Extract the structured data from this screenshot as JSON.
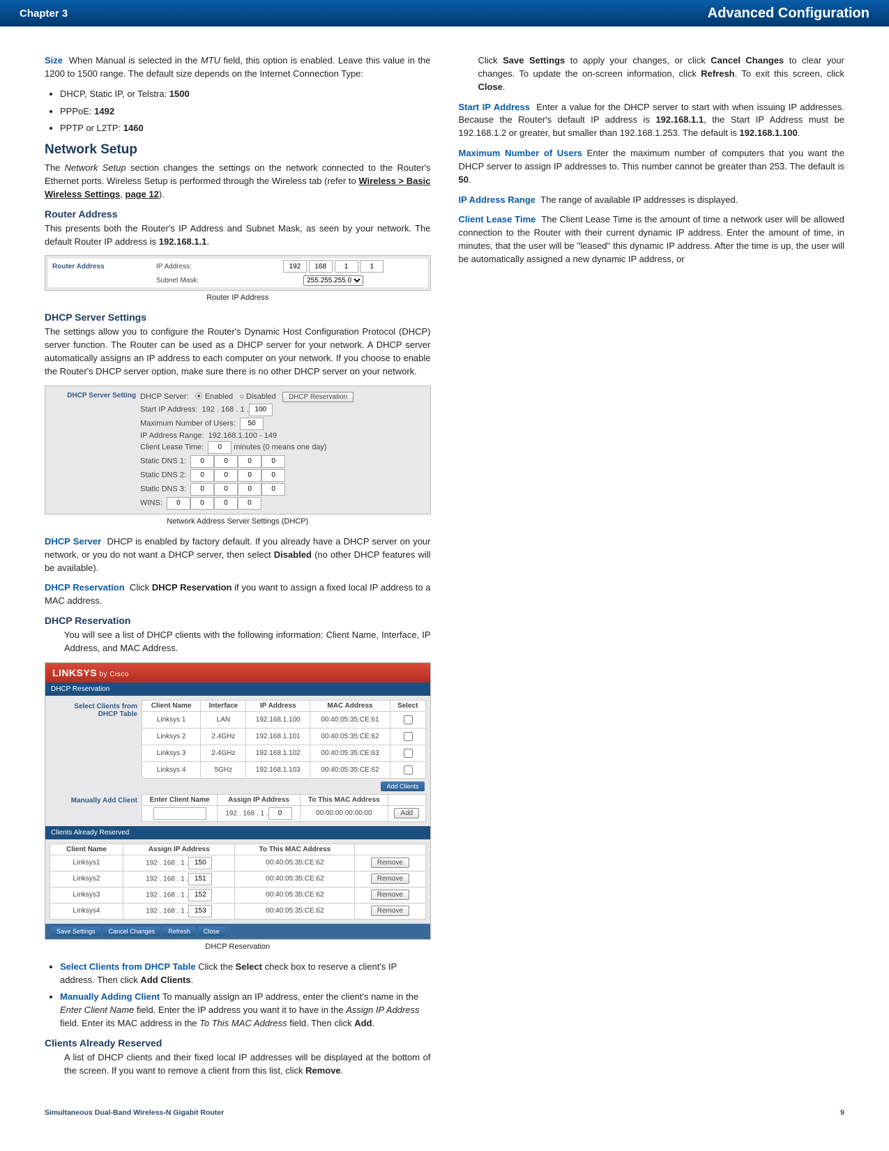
{
  "header": {
    "chapter": "Chapter 3",
    "title": "Advanced Configuration"
  },
  "para_size": {
    "term": "Size",
    "body": "When Manual is selected in the ",
    "ital1": "MTU",
    "body2": " field, this option is enabled. Leave this value in the 1200 to 1500 range. The default size depends on the Internet Connection Type:"
  },
  "size_list": {
    "i1a": "DHCP, Static IP, or Telstra: ",
    "i1b": "1500",
    "i2a": "PPPoE: ",
    "i2b": "1492",
    "i3a": "PPTP or L2TP: ",
    "i3b": "1460"
  },
  "h_netsetup": "Network Setup",
  "p_netsetup_a": "The ",
  "p_netsetup_ital": "Network Setup",
  "p_netsetup_b": " section changes the settings on the network connected to the Router's Ethernet ports. Wireless Setup is performed through the Wireless tab (refer to ",
  "p_netsetup_link": "Wireless > Basic Wireless Settings",
  "p_netsetup_c": ", ",
  "p_netsetup_page": "page 12",
  "p_netsetup_d": ").",
  "h_routeraddr": "Router Address",
  "p_routeraddr_a": "This presents both the Router's IP Address and Subnet Mask, as seen by your network. The default Router IP address is ",
  "p_routeraddr_b": "192.168.1.1",
  "p_routeraddr_c": ".",
  "fig_router": {
    "panel": "Router Address",
    "row1k": "IP Address:",
    "ip1": "192",
    "ip2": "168",
    "ip3": "1",
    "ip4": "1",
    "row2k": "Subnet Mask:",
    "mask": "255.255.255.0",
    "caption": "Router IP Address"
  },
  "h_dhcp": "DHCP Server Settings",
  "p_dhcp_intro": "The settings allow you to configure the Router's Dynamic Host Configuration Protocol (DHCP) server function. The Router can be used as a DHCP server for your network. A DHCP server automatically assigns an IP address to each computer on your network. If you choose to enable the Router's DHCP server option, make sure there is no other DHCP server on your network.",
  "fig_dhcpset": {
    "panel": "DHCP Server Setting",
    "row_srv": "DHCP Server:",
    "opt_en": "Enabled",
    "opt_dis": "Disabled",
    "btn_res": "DHCP Reservation",
    "row_start": "Start IP Address:",
    "start_pref": "192 . 168 . 1 .",
    "start_last": "100",
    "row_max": "Maximum Number of Users:",
    "max_val": "50",
    "row_range": "IP Address Range:",
    "range_val": "192.168.1.100 - 149",
    "row_lease": "Client Lease Time:",
    "lease_val": "0",
    "lease_note": "minutes (0 means one day)",
    "row_d1": "Static DNS 1:",
    "row_d2": "Static DNS 2:",
    "row_d3": "Static DNS 3:",
    "row_wins": "WINS:",
    "zero": "0",
    "caption": "Network Address Server Settings (DHCP)"
  },
  "p_dhcpserver": {
    "term": "DHCP Server",
    "a": "DHCP is enabled by factory default. If you already have a DHCP server on your network, or you do not want a DHCP server, then select ",
    "b": "Disabled",
    "c": " (no other DHCP features will be available)."
  },
  "p_dhcpres": {
    "term": "DHCP Reservation",
    "a": "Click ",
    "b": "DHCP Reservation",
    "c": " if you want to assign a fixed local IP address to a MAC address."
  },
  "h_dhcpres": "DHCP Reservation",
  "p_dhcpres_list": "You will see a list of DHCP clients with the following information: Client Name, Interface, IP Address, and MAC Address.",
  "fig_res": {
    "brand": "LINKSYS",
    "by": "by Cisco",
    "tab": "DHCP Reservation",
    "sec1": "Select Clients from DHCP Table",
    "t1_headers": [
      "Client Name",
      "Interface",
      "IP Address",
      "MAC Address",
      "Select"
    ],
    "t1_rows": [
      {
        "n": "Linksys 1",
        "if": "LAN",
        "ip": "192.168.1.100",
        "mac": "00:40:05:35:CE:61"
      },
      {
        "n": "Linksys 2",
        "if": "2.4GHz",
        "ip": "192.168.1.101",
        "mac": "00:40:05:35:CE:62"
      },
      {
        "n": "Linksys 3",
        "if": "2.4GHz",
        "ip": "192.168.1.102",
        "mac": "00:40:05:35:CE:63"
      },
      {
        "n": "Linksys 4",
        "if": "5GHz",
        "ip": "192.168.1.103",
        "mac": "00:40:05:35:CE:62"
      }
    ],
    "btn_addclients": "Add Clients",
    "sec2": "Manually Add Client",
    "t2_headers": [
      "Enter Client Name",
      "Assign IP Address",
      "To This MAC Address"
    ],
    "t2_ip_pref": "192 . 168 . 1 .",
    "t2_ip_last": "0",
    "t2_mac": "00:00:00:00:00:00",
    "btn_add": "Add",
    "sec3": "Clients Already Reserved",
    "t3_headers": [
      "Client Name",
      "Assign IP Address",
      "To This MAC Address",
      ""
    ],
    "t3_rows": [
      {
        "n": "Linksys1",
        "ip_pref": "192 . 168 . 1 .",
        "ip": "150",
        "mac": "00:40:05:35:CE:62",
        "btn": "Remove"
      },
      {
        "n": "Linksys2",
        "ip_pref": "192 . 168 . 1 .",
        "ip": "151",
        "mac": "00:40:05:35:CE:62",
        "btn": "Remove"
      },
      {
        "n": "Linksys3",
        "ip_pref": "192 . 168 . 1 .",
        "ip": "152",
        "mac": "00:40:05:35:CE:62",
        "btn": "Remove"
      },
      {
        "n": "Linksys4",
        "ip_pref": "192 . 168 . 1 .",
        "ip": "153",
        "mac": "00:40:05:35:CE:62",
        "btn": "Remove"
      }
    ],
    "footer_btns": [
      "Save Settings",
      "Cancel Changes",
      "Refresh",
      "Close"
    ],
    "caption": "DHCP Reservation"
  },
  "bul_select": {
    "term": "Select Clients from DHCP Table",
    "a": "Click the ",
    "b": "Select",
    "c": " check box to reserve a client's IP address. Then click ",
    "d": "Add Clients",
    "e": "."
  },
  "bul_manual": {
    "term": "Manually Adding Client",
    "a": "To manually assign an IP address, enter the client's name in the ",
    "i1": "Enter Client Name",
    "b": " field. Enter the IP address you want it to have in the ",
    "i2": "Assign IP Address",
    "c": " field. Enter its MAC address in the ",
    "i3": "To This MAC Address",
    "d": " field. Then click ",
    "e": "Add",
    "f": "."
  },
  "h_already": "Clients Already Reserved",
  "p_already_a": "A list of DHCP clients and their fixed local IP addresses will be displayed at the bottom of the screen. If you want to remove a client from this list, click ",
  "p_already_b": "Remove",
  "p_already_c": ".",
  "p_save_a": "Click ",
  "p_save_b": "Save Settings",
  "p_save_c": " to apply your changes, or click ",
  "p_save_d": "Cancel Changes",
  "p_save_e": " to clear your changes. To update the on-screen information, click ",
  "p_save_f": "Refresh",
  "p_save_g": ". To exit this screen, click ",
  "p_save_h": "Close",
  "p_save_i": ".",
  "p_startip": {
    "term": "Start IP Address",
    "a": "Enter a value for the DHCP server to start with when issuing IP addresses. Because the Router's default IP address is ",
    "b": "192.168.1.1",
    "c": ", the Start IP Address must be 192.168.1.2 or greater, but smaller than 192.168.1.253. The default is ",
    "d": "192.168.1.100",
    "e": "."
  },
  "p_maxusers": {
    "term": "Maximum Number of Users",
    "a": "Enter the maximum number of computers that you want the DHCP server to assign IP addresses to. This number cannot be greater than 253. The default is ",
    "b": "50",
    "c": "."
  },
  "p_iprange": {
    "term": "IP Address Range",
    "a": "The range of available IP addresses is displayed."
  },
  "p_lease": {
    "term": "Client Lease Time",
    "a": "The Client Lease Time is the amount of time a network user will be allowed connection to the Router with their current dynamic IP address. Enter the amount of time, in minutes, that the user will be \"leased\" this dynamic IP address. After the time is up, the user will be automatically assigned a new dynamic IP address, or"
  },
  "footer": {
    "product": "Simultaneous Dual-Band Wireless-N Gigabit Router",
    "page": "9"
  }
}
